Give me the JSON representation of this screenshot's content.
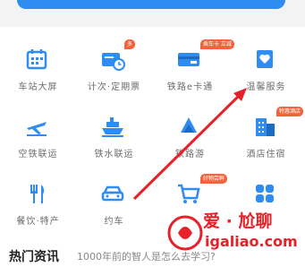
{
  "grid": [
    {
      "label": "车站大屏",
      "icon": "calendar-icon",
      "badge": ""
    },
    {
      "label": "计次·定期票",
      "icon": "ticket-clock-icon",
      "badge": "多"
    },
    {
      "label": "铁路e卡通",
      "icon": "card-icon",
      "badge": "乘车卡 立减"
    },
    {
      "label": "温馨服务",
      "icon": "heart-box-icon",
      "badge": ""
    },
    {
      "label": "空铁联运",
      "icon": "plane-icon",
      "badge": ""
    },
    {
      "label": "铁水联运",
      "icon": "ship-icon",
      "badge": ""
    },
    {
      "label": "铁路游",
      "icon": "tour-icon",
      "badge": ""
    },
    {
      "label": "酒店住宿",
      "icon": "hotel-icon",
      "badge": "特惠酒店"
    },
    {
      "label": "餐饮·特产",
      "icon": "dining-icon",
      "badge": ""
    },
    {
      "label": "约车",
      "icon": "car-icon",
      "badge": ""
    },
    {
      "label": "",
      "icon": "cart-icon",
      "badge": "好物尝鲜"
    },
    {
      "label": "",
      "icon": "more-grid-icon",
      "badge": ""
    }
  ],
  "news": {
    "title": "热门资讯",
    "text": "1000年前的智人是怎么去学习?"
  },
  "watermark": {
    "brand": "爱 · 尬聊",
    "url": "igaliao.com"
  },
  "colors": {
    "primary": "#2f8cf0",
    "badge": "#f0643c",
    "arrow": "#e62129"
  }
}
